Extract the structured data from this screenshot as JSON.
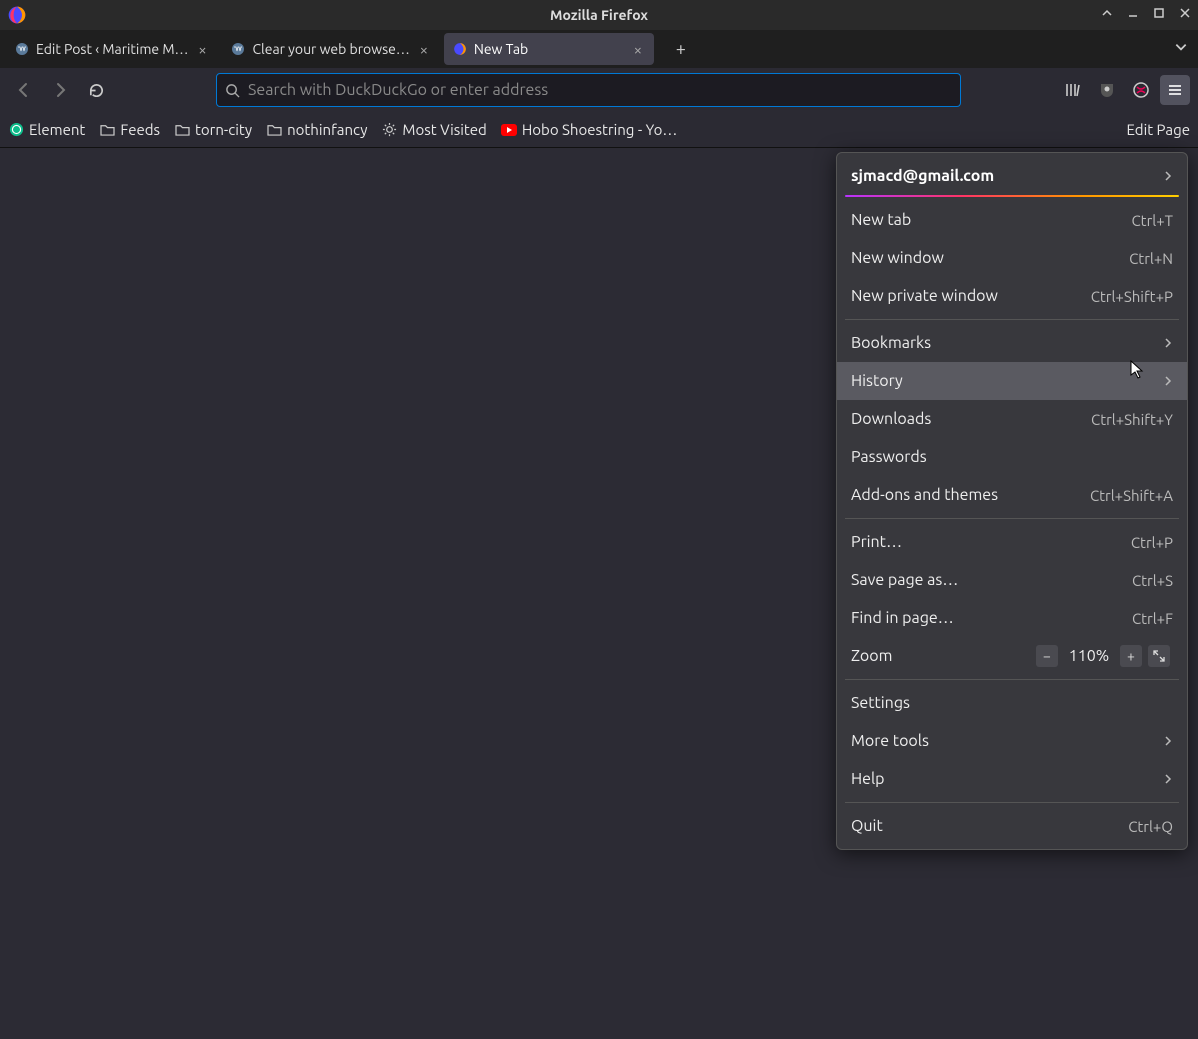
{
  "window": {
    "title": "Mozilla Firefox"
  },
  "tabs": [
    {
      "title": "Edit Post ‹ Maritime M…"
    },
    {
      "title": "Clear your web browse…"
    },
    {
      "title": "New Tab"
    }
  ],
  "urlbar": {
    "placeholder": "Search with DuckDuckGo or enter address"
  },
  "bookmarks": [
    {
      "label": "Element",
      "icon": "element"
    },
    {
      "label": "Feeds",
      "icon": "folder"
    },
    {
      "label": "torn-city",
      "icon": "folder"
    },
    {
      "label": "nothinfancy",
      "icon": "folder"
    },
    {
      "label": "Most Visited",
      "icon": "gear"
    },
    {
      "label": "Hobo Shoestring - Yo…",
      "icon": "youtube"
    }
  ],
  "bookmarks_overflow": "Edit Page",
  "menu": {
    "account": "sjmacd@gmail.com",
    "items_a": [
      {
        "label": "New tab",
        "shortcut": "Ctrl+T"
      },
      {
        "label": "New window",
        "shortcut": "Ctrl+N"
      },
      {
        "label": "New private window",
        "shortcut": "Ctrl+Shift+P"
      }
    ],
    "items_b": [
      {
        "label": "Bookmarks",
        "submenu": true
      },
      {
        "label": "History",
        "submenu": true,
        "hover": true
      },
      {
        "label": "Downloads",
        "shortcut": "Ctrl+Shift+Y"
      },
      {
        "label": "Passwords"
      },
      {
        "label": "Add-ons and themes",
        "shortcut": "Ctrl+Shift+A"
      }
    ],
    "items_c": [
      {
        "label": "Print…",
        "shortcut": "Ctrl+P"
      },
      {
        "label": "Save page as…",
        "shortcut": "Ctrl+S"
      },
      {
        "label": "Find in page…",
        "shortcut": "Ctrl+F"
      }
    ],
    "zoom": {
      "label": "Zoom",
      "value": "110%"
    },
    "items_d": [
      {
        "label": "Settings"
      },
      {
        "label": "More tools",
        "submenu": true
      },
      {
        "label": "Help",
        "submenu": true
      }
    ],
    "items_e": [
      {
        "label": "Quit",
        "shortcut": "Ctrl+Q"
      }
    ]
  }
}
